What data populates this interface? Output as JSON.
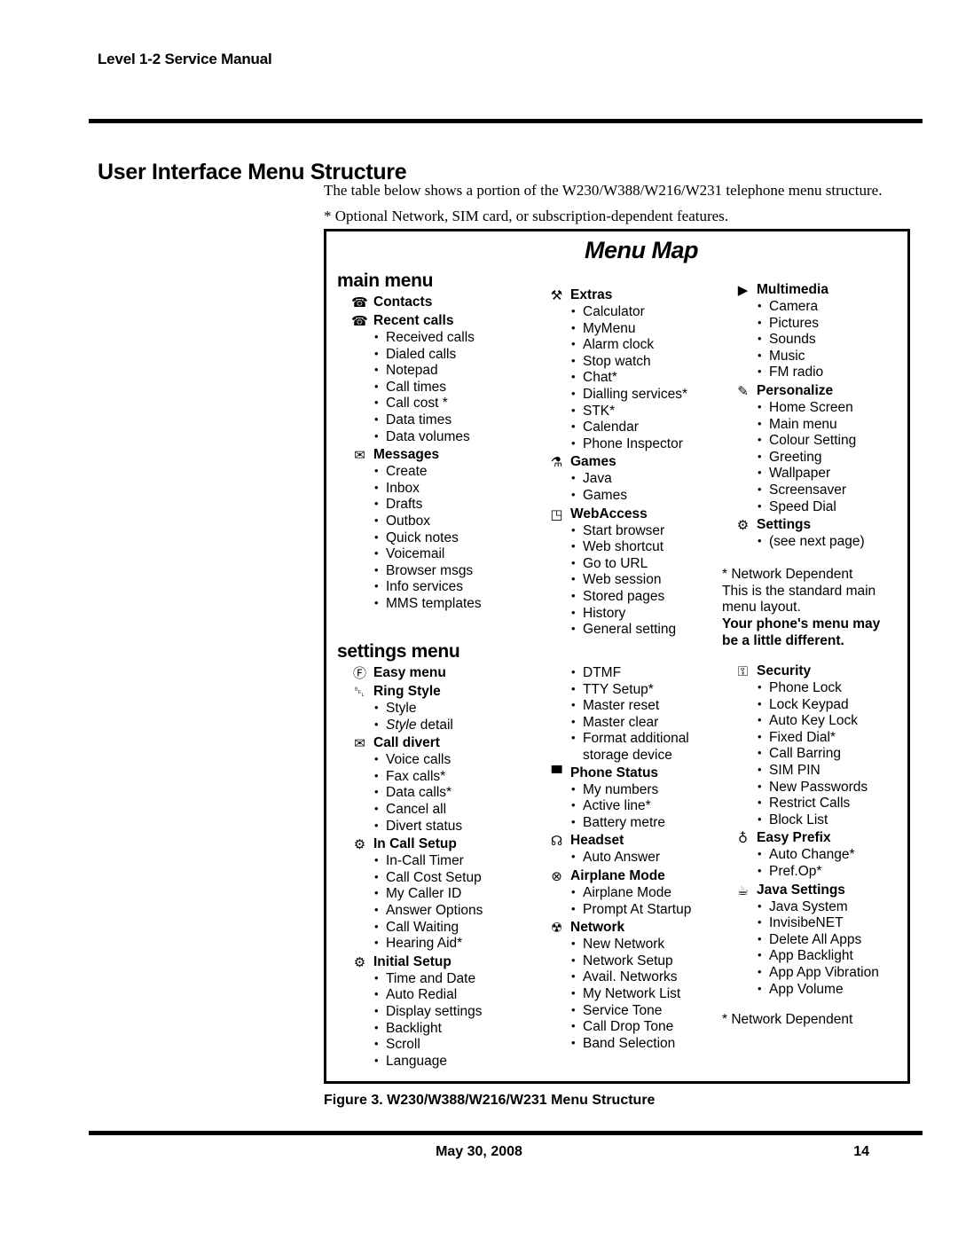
{
  "page": {
    "running_head": "Level 1-2 Service Manual",
    "title": "User Interface Menu Structure",
    "intro_line1": "The table below shows a portion of the W230/W388/W216/W231 telephone menu structure.",
    "intro_line2": "* Optional Network, SIM card, or subscription-dependent features.",
    "figure_caption": "Figure 3.  W230/W388/W216/W231 Menu Structure",
    "footer_date": "May 30, 2008",
    "footer_page": "14"
  },
  "menu_map": {
    "title": "Menu Map",
    "main_label": "main menu",
    "settings_label": "settings menu",
    "main_menu": {
      "col_a": [
        {
          "icon": "contacts-icon",
          "title": "Contacts",
          "items": []
        },
        {
          "icon": "recent-calls-icon",
          "title": "Recent calls",
          "items": [
            "Received calls",
            "Dialed calls",
            "Notepad",
            "Call times",
            "Call cost *",
            "Data times",
            "Data volumes"
          ]
        },
        {
          "icon": "messages-envelope-icon",
          "title": "Messages",
          "items": [
            "Create",
            "Inbox",
            "Drafts",
            "Outbox",
            "Quick notes",
            "Voicemail",
            "Browser msgs",
            "Info services",
            "MMS templates"
          ]
        }
      ],
      "col_b": [
        {
          "icon": "extras-icon",
          "title": "Extras",
          "items": [
            "Calculator",
            "MyMenu",
            "Alarm clock",
            "Stop watch",
            "Chat*",
            "Dialling services*",
            "STK*",
            "Calendar",
            "Phone Inspector"
          ]
        },
        {
          "icon": "games-joystick-icon",
          "title": "Games",
          "items": [
            "Java",
            "Games"
          ]
        },
        {
          "icon": "webaccess-icon",
          "title": "WebAccess",
          "items": [
            "Start browser",
            "Web shortcut",
            "Go to URL",
            "Web session",
            "Stored pages",
            "History",
            "General setting"
          ]
        }
      ],
      "col_c": [
        {
          "icon": "multimedia-icon",
          "title": "Multimedia",
          "items": [
            "Camera",
            "Pictures",
            "Sounds",
            "Music",
            "FM radio"
          ]
        },
        {
          "icon": "personalize-icon",
          "title": "Personalize",
          "items": [
            "Home Screen",
            "Main menu",
            "Colour Setting",
            "Greeting",
            "Wallpaper",
            "Screensaver",
            "Speed Dial"
          ]
        },
        {
          "icon": "settings-tools-icon",
          "title": "Settings",
          "items": [
            "(see next page)"
          ]
        }
      ],
      "note": {
        "line1": "* Network Dependent",
        "line2": "This is the standard main",
        "line3": "menu layout.",
        "bold1": "Your phone's menu may",
        "bold2": "be a little different."
      }
    },
    "settings_menu": {
      "col_a": [
        {
          "icon": "easy-menu-icon",
          "title": "Easy menu",
          "items": []
        },
        {
          "icon": "ring-style-bell-icon",
          "title": "Ring Style",
          "items": [
            "Style",
            "Style detail"
          ],
          "italic_index": 1,
          "italic_word": "Style"
        },
        {
          "icon": "call-divert-icon",
          "title": "Call divert",
          "items": [
            "Voice calls",
            "Fax calls*",
            "Data calls*",
            "Cancel all",
            "Divert status"
          ]
        },
        {
          "icon": "in-call-setup-icon",
          "title": "In Call Setup",
          "items": [
            "In-Call Timer",
            "Call Cost Setup",
            "My Caller ID",
            "Answer Options",
            "Call Waiting",
            "Hearing Aid*"
          ]
        },
        {
          "icon": "initial-setup-icon",
          "title": "Initial Setup",
          "items": [
            "Time and Date",
            "Auto Redial",
            "Display settings",
            "Backlight",
            "Scroll",
            "Language"
          ]
        }
      ],
      "col_b_continued": [
        "DTMF",
        "TTY Setup*",
        "Master reset",
        "Master clear",
        "Format additional storage device"
      ],
      "col_b": [
        {
          "icon": "phone-status-icon",
          "title": "Phone Status",
          "items": [
            "My numbers",
            "Active line*",
            "Battery metre"
          ]
        },
        {
          "icon": "headset-icon",
          "title": "Headset",
          "items": [
            "Auto Answer"
          ]
        },
        {
          "icon": "airplane-mode-icon",
          "title": "Airplane Mode",
          "items": [
            "Airplane Mode",
            "Prompt At Startup"
          ]
        },
        {
          "icon": "network-tower-icon",
          "title": "Network",
          "items": [
            "New Network",
            "Network Setup",
            "Avail. Networks",
            "My Network List",
            "Service Tone",
            "Call Drop Tone",
            "Band Selection"
          ]
        }
      ],
      "col_c": [
        {
          "icon": "security-lock-icon",
          "title": "Security",
          "items": [
            "Phone Lock",
            "Lock Keypad",
            "Auto Key Lock",
            "Fixed Dial*",
            "Call Barring",
            "SIM PIN",
            "New Passwords",
            "Restrict Calls",
            "Block List"
          ]
        },
        {
          "icon": "easy-prefix-icon",
          "title": "Easy Prefix",
          "items": [
            "Auto Change*",
            "Pref.Op*"
          ]
        },
        {
          "icon": "java-settings-icon",
          "title": "Java Settings",
          "items": [
            "Java System",
            "InvisibeNET",
            "Delete All Apps",
            "App Backlight",
            "App App Vibration",
            "App Volume"
          ]
        }
      ],
      "note": {
        "line1": "* Network Dependent"
      }
    }
  }
}
